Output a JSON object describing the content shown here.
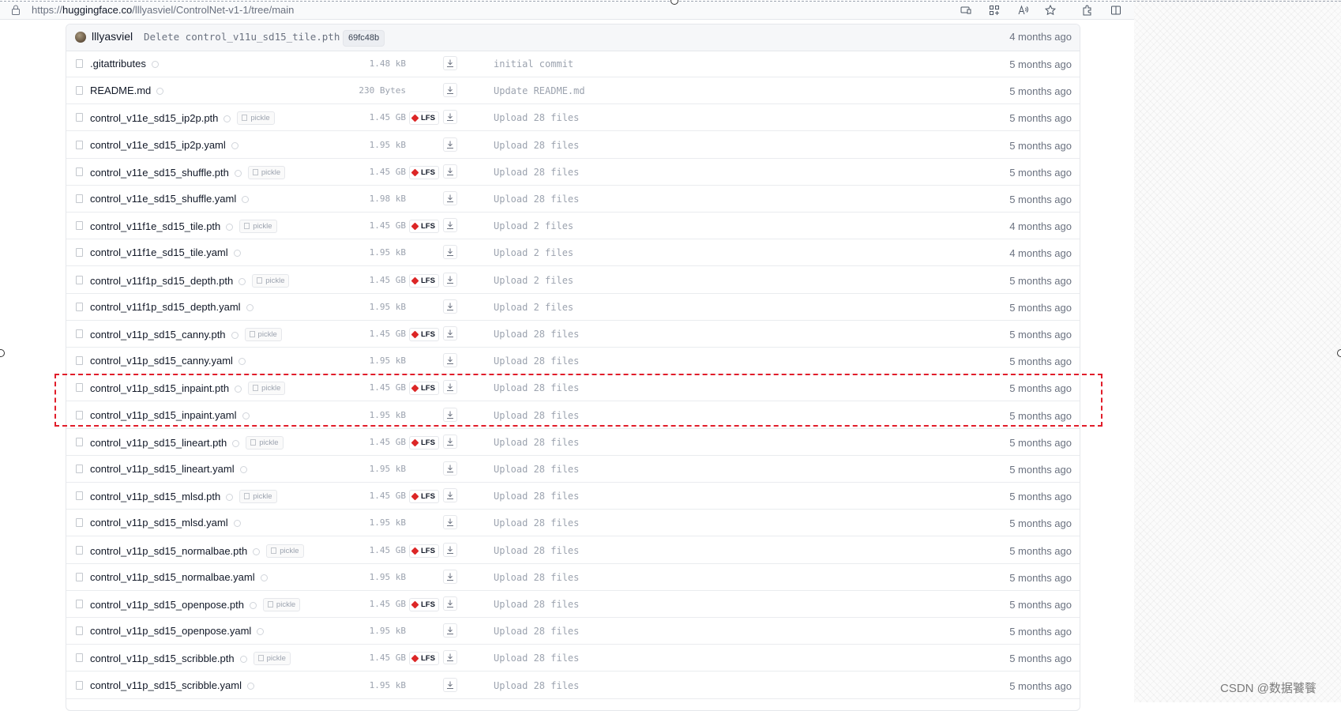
{
  "browser": {
    "url_prefix": "https://",
    "url_host": "huggingface.co",
    "url_path": "/lllyasviel/ControlNet-v1-1/tree/main"
  },
  "last_commit": {
    "author": "lllyasviel",
    "message": "Delete control_v11u_sd15_tile.pth",
    "hash": "69fc48b",
    "time": "4 months ago"
  },
  "files": [
    {
      "name": ".gitattributes",
      "size": "1.48 kB",
      "pickle": false,
      "lfs": false,
      "commit": "initial commit",
      "time": "5 months ago"
    },
    {
      "name": "README.md",
      "size": "230 Bytes",
      "pickle": false,
      "lfs": false,
      "commit": "Update README.md",
      "time": "5 months ago"
    },
    {
      "name": "control_v11e_sd15_ip2p.pth",
      "size": "1.45 GB",
      "pickle": true,
      "lfs": true,
      "commit": "Upload 28 files",
      "time": "5 months ago"
    },
    {
      "name": "control_v11e_sd15_ip2p.yaml",
      "size": "1.95 kB",
      "pickle": false,
      "lfs": false,
      "commit": "Upload 28 files",
      "time": "5 months ago"
    },
    {
      "name": "control_v11e_sd15_shuffle.pth",
      "size": "1.45 GB",
      "pickle": true,
      "lfs": true,
      "commit": "Upload 28 files",
      "time": "5 months ago"
    },
    {
      "name": "control_v11e_sd15_shuffle.yaml",
      "size": "1.98 kB",
      "pickle": false,
      "lfs": false,
      "commit": "Upload 28 files",
      "time": "5 months ago"
    },
    {
      "name": "control_v11f1e_sd15_tile.pth",
      "size": "1.45 GB",
      "pickle": true,
      "lfs": true,
      "commit": "Upload 2 files",
      "time": "4 months ago"
    },
    {
      "name": "control_v11f1e_sd15_tile.yaml",
      "size": "1.95 kB",
      "pickle": false,
      "lfs": false,
      "commit": "Upload 2 files",
      "time": "4 months ago"
    },
    {
      "name": "control_v11f1p_sd15_depth.pth",
      "size": "1.45 GB",
      "pickle": true,
      "lfs": true,
      "commit": "Upload 2 files",
      "time": "5 months ago"
    },
    {
      "name": "control_v11f1p_sd15_depth.yaml",
      "size": "1.95 kB",
      "pickle": false,
      "lfs": false,
      "commit": "Upload 2 files",
      "time": "5 months ago"
    },
    {
      "name": "control_v11p_sd15_canny.pth",
      "size": "1.45 GB",
      "pickle": true,
      "lfs": true,
      "commit": "Upload 28 files",
      "time": "5 months ago"
    },
    {
      "name": "control_v11p_sd15_canny.yaml",
      "size": "1.95 kB",
      "pickle": false,
      "lfs": false,
      "commit": "Upload 28 files",
      "time": "5 months ago"
    },
    {
      "name": "control_v11p_sd15_inpaint.pth",
      "size": "1.45 GB",
      "pickle": true,
      "lfs": true,
      "commit": "Upload 28 files",
      "time": "5 months ago"
    },
    {
      "name": "control_v11p_sd15_inpaint.yaml",
      "size": "1.95 kB",
      "pickle": false,
      "lfs": false,
      "commit": "Upload 28 files",
      "time": "5 months ago"
    },
    {
      "name": "control_v11p_sd15_lineart.pth",
      "size": "1.45 GB",
      "pickle": true,
      "lfs": true,
      "commit": "Upload 28 files",
      "time": "5 months ago"
    },
    {
      "name": "control_v11p_sd15_lineart.yaml",
      "size": "1.95 kB",
      "pickle": false,
      "lfs": false,
      "commit": "Upload 28 files",
      "time": "5 months ago"
    },
    {
      "name": "control_v11p_sd15_mlsd.pth",
      "size": "1.45 GB",
      "pickle": true,
      "lfs": true,
      "commit": "Upload 28 files",
      "time": "5 months ago"
    },
    {
      "name": "control_v11p_sd15_mlsd.yaml",
      "size": "1.95 kB",
      "pickle": false,
      "lfs": false,
      "commit": "Upload 28 files",
      "time": "5 months ago"
    },
    {
      "name": "control_v11p_sd15_normalbae.pth",
      "size": "1.45 GB",
      "pickle": true,
      "lfs": true,
      "commit": "Upload 28 files",
      "time": "5 months ago"
    },
    {
      "name": "control_v11p_sd15_normalbae.yaml",
      "size": "1.95 kB",
      "pickle": false,
      "lfs": false,
      "commit": "Upload 28 files",
      "time": "5 months ago"
    },
    {
      "name": "control_v11p_sd15_openpose.pth",
      "size": "1.45 GB",
      "pickle": true,
      "lfs": true,
      "commit": "Upload 28 files",
      "time": "5 months ago"
    },
    {
      "name": "control_v11p_sd15_openpose.yaml",
      "size": "1.95 kB",
      "pickle": false,
      "lfs": false,
      "commit": "Upload 28 files",
      "time": "5 months ago"
    },
    {
      "name": "control_v11p_sd15_scribble.pth",
      "size": "1.45 GB",
      "pickle": true,
      "lfs": true,
      "commit": "Upload 28 files",
      "time": "5 months ago"
    },
    {
      "name": "control_v11p_sd15_scribble.yaml",
      "size": "1.95 kB",
      "pickle": false,
      "lfs": false,
      "commit": "Upload 28 files",
      "time": "5 months ago"
    }
  ],
  "labels": {
    "pickle": "pickle",
    "lfs": "LFS"
  },
  "highlighted_files": [
    "control_v11p_sd15_inpaint.pth",
    "control_v11p_sd15_inpaint.yaml"
  ],
  "highlight_color": "#e11d2a",
  "lfs_icon_color": "#dc2626",
  "watermark": "CSDN @数据饕餮",
  "toolbar_icons": [
    "tab-cast-icon",
    "apps-icon",
    "read-aloud-icon",
    "favorite-star-icon",
    "extensions-icon",
    "split-screen-icon"
  ]
}
